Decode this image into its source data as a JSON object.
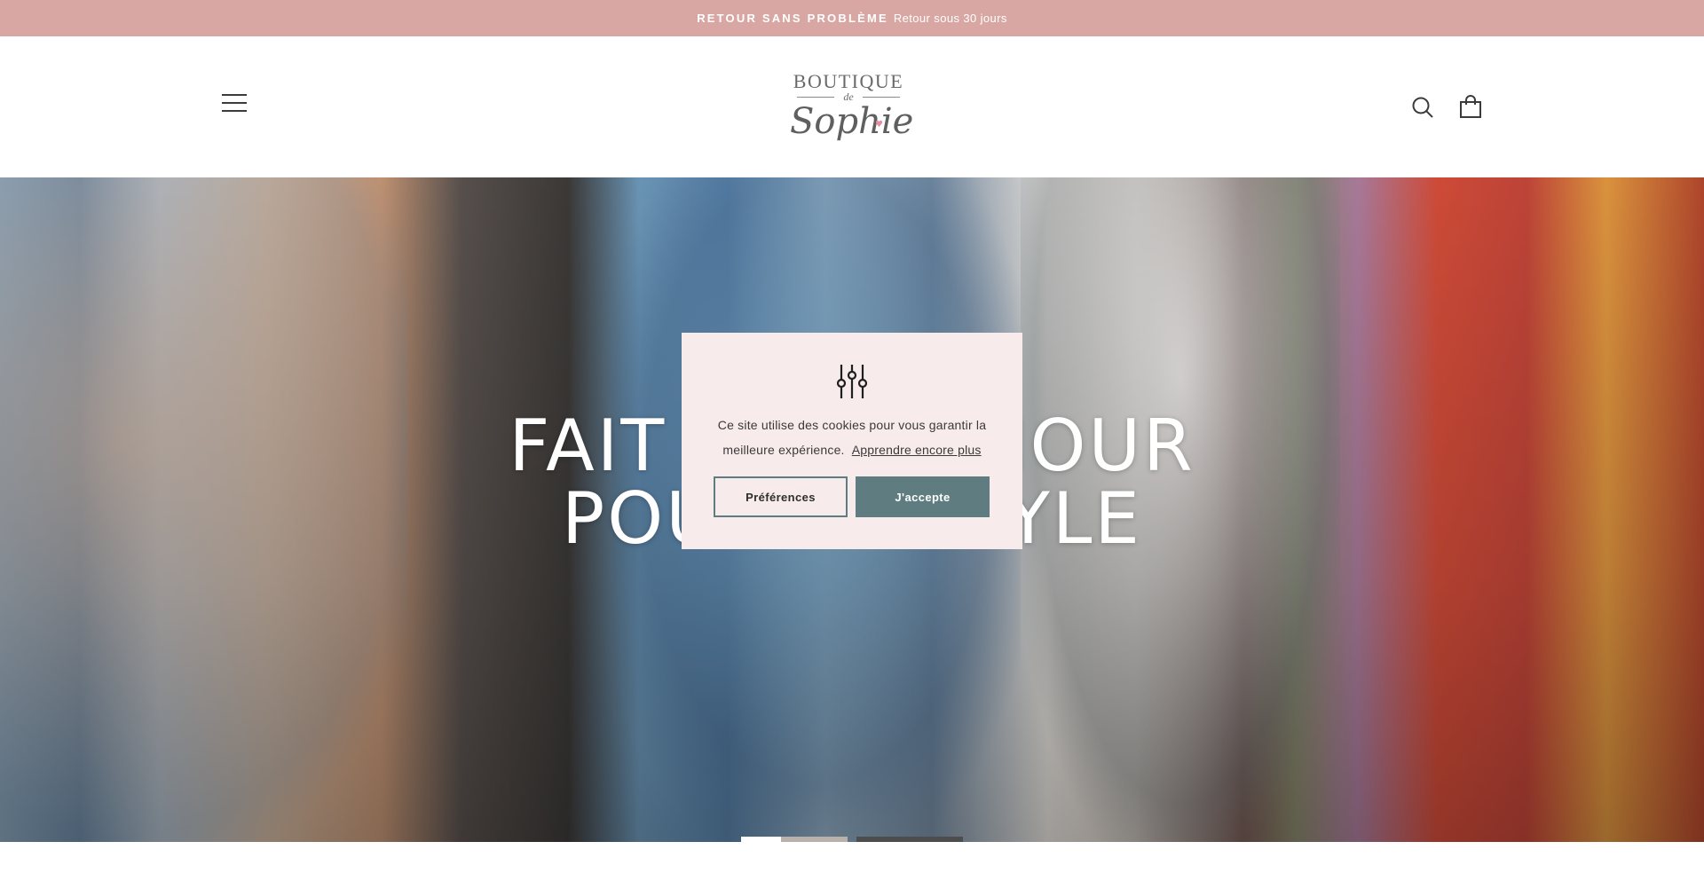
{
  "announcement": {
    "strong": "RETOUR SANS PROBLÈME",
    "text": "Retour sous 30 jours"
  },
  "header": {
    "logo": {
      "line1": "BOUTIQUE",
      "line2": "de",
      "line3": "Sophie"
    },
    "icons": [
      "hamburger-menu-icon",
      "search-icon",
      "shopping-bag-icon"
    ]
  },
  "hero": {
    "title_line1": "FAIT AVEC AMOUR",
    "title_line2": "POUR LE STYLE",
    "slides": 2,
    "active_slide": 1
  },
  "cookie_banner": {
    "message": "Ce site utilise des cookies pour vous garantir la meilleure expérience.",
    "learn_more": "Apprendre encore plus",
    "preferences_label": "Préférences",
    "accept_label": "J'accepte",
    "icon": "sliders-icon"
  },
  "colors": {
    "announcement_bg": "#d9a7a3",
    "cookie_bg": "#f8ebec",
    "button_accent": "#5f7d80"
  }
}
